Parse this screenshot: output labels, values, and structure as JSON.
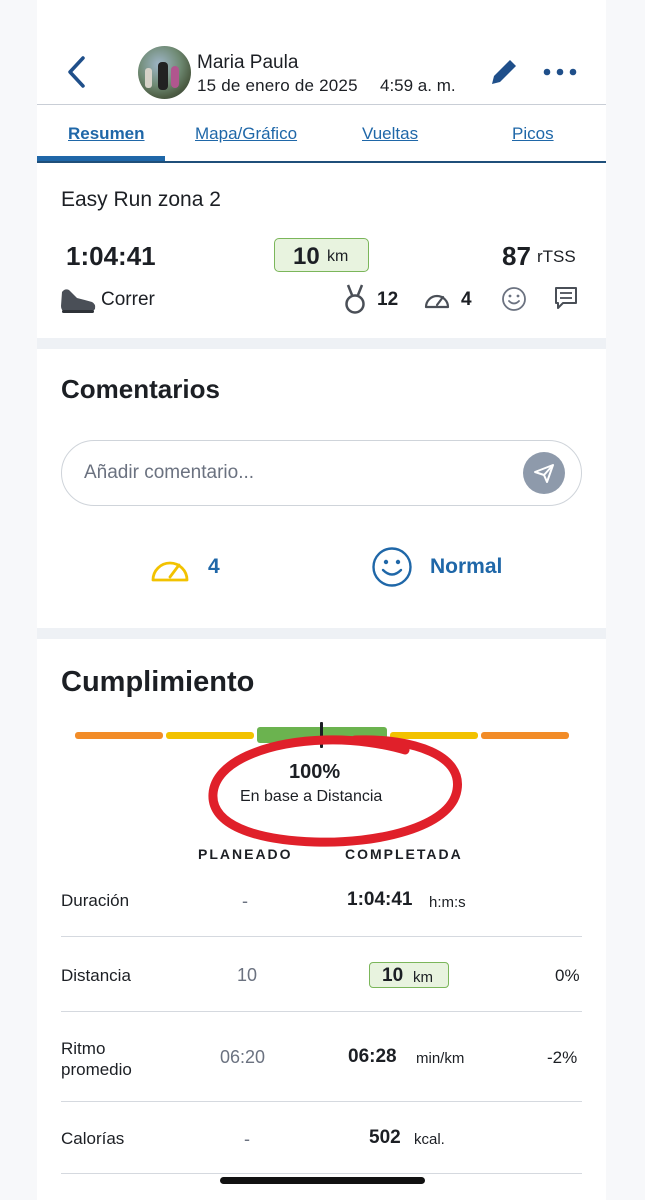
{
  "header": {
    "back_icon": "chevron-left-icon",
    "user_name": "Maria Paula",
    "date": "15 de enero de 2025",
    "time": "4:59 a. m.",
    "edit_icon": "pencil-icon",
    "more_icon": "more-horizontal-icon"
  },
  "tabs": [
    {
      "label": "Resumen",
      "active": true
    },
    {
      "label": "Mapa/Gráfico",
      "active": false
    },
    {
      "label": "Vueltas",
      "active": false
    },
    {
      "label": "Picos",
      "active": false
    }
  ],
  "workout": {
    "title": "Easy Run zona 2",
    "duration": "1:04:41",
    "distance_value": "10",
    "distance_unit": "km",
    "tss_value": "87",
    "tss_unit": "rTSS",
    "sport_icon": "shoe-icon",
    "sport": "Correr",
    "medals_icon": "medal-icon",
    "medals": "12",
    "effort_icon": "gauge-icon",
    "effort": "4",
    "feel_icon": "smile-icon",
    "comment_icon": "comment-icon"
  },
  "comments": {
    "title": "Comentarios",
    "placeholder": "Añadir comentario...",
    "send_icon": "send-icon",
    "rpe_value": "4",
    "feel_label": "Normal"
  },
  "compliance": {
    "title": "Cumplimiento",
    "percent": "100%",
    "basis": "En base a Distancia",
    "bar_colors": [
      "#f28c28",
      "#f2c200",
      "#6bb34f",
      "#f2c200",
      "#f28c28"
    ],
    "accent_color": "#1f67a8",
    "annotation_color": "#e0202a",
    "col_planned": "PLANEADO",
    "col_completed": "COMPLETADA",
    "rows": [
      {
        "label": "Duración",
        "planned": "-",
        "completed": "1:04:41",
        "unit": "h:m:s",
        "diff": ""
      },
      {
        "label": "Distancia",
        "planned": "10",
        "completed": "10",
        "unit": "km",
        "diff": "0%"
      },
      {
        "label_line1": "Ritmo",
        "label_line2": "promedio",
        "planned": "06:20",
        "completed": "06:28",
        "unit": "min/km",
        "diff": "-2%"
      },
      {
        "label": "Calorías",
        "planned": "-",
        "completed": "502",
        "unit": "kcal.",
        "diff": ""
      }
    ]
  }
}
